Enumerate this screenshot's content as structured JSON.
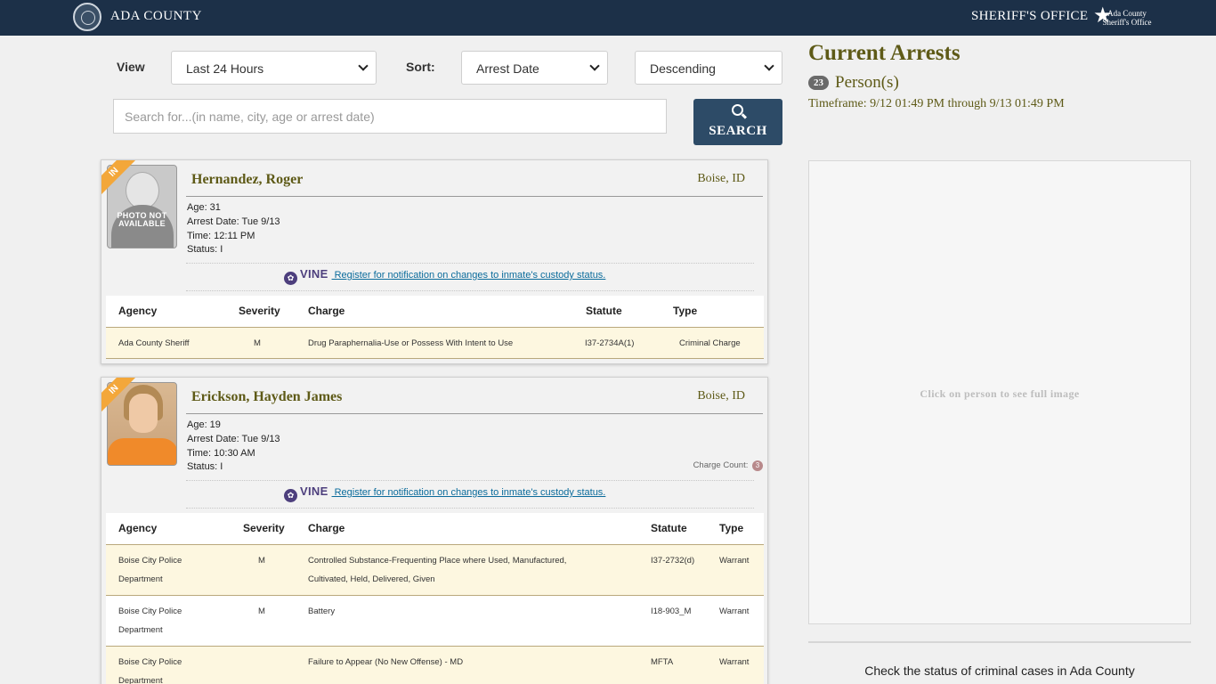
{
  "header": {
    "county": "ADA COUNTY",
    "office": "SHERIFF'S OFFICE",
    "logo_line1": "Ada County",
    "logo_line2": "Sheriff's Office"
  },
  "controls": {
    "view_label": "View",
    "view_value": "Last 24 Hours",
    "sort_label": "Sort:",
    "sort_value": "Arrest Date",
    "order_value": "Descending",
    "search_placeholder": "Search for...(in name, city, age or arrest date)",
    "search_button": "SEARCH"
  },
  "columns": {
    "agency": "Agency",
    "severity": "Severity",
    "charge": "Charge",
    "statute": "Statute",
    "type": "Type"
  },
  "vine": {
    "brand": "VINE",
    "link": " Register for notification on changes to inmate's custody status."
  },
  "arrests": [
    {
      "ribbon": "IN",
      "photo_text": "PHOTO NOT AVAILABLE",
      "name": "Hernandez, Roger",
      "city": "Boise, ID",
      "age": "Age: 31",
      "arrest_date": "Arrest Date: Tue 9/13",
      "time": "Time: 12:11 PM",
      "status": "Status: I",
      "charges": [
        {
          "agency": "Ada County Sheriff",
          "severity": "M",
          "charge": "Drug Paraphernalia-Use or Possess With Intent to Use",
          "statute": "I37-2734A(1)",
          "type": "Criminal Charge"
        }
      ]
    },
    {
      "ribbon": "IN",
      "name": "Erickson, Hayden James",
      "city": "Boise, ID",
      "age": "Age: 19",
      "arrest_date": "Arrest Date: Tue 9/13",
      "time": "Time: 10:30 AM",
      "status": "Status: I",
      "charge_count_label": "Charge Count:",
      "charge_count": "3",
      "charges": [
        {
          "agency": "Boise City Police Department",
          "severity": "M",
          "charge": "Controlled Substance-Frequenting Place where Used, Manufactured, Cultivated, Held, Delivered, Given",
          "statute": "I37-2732(d)",
          "type": "Warrant"
        },
        {
          "agency": "Boise City Police Department",
          "severity": "M",
          "charge": "Battery",
          "statute": "I18-903_M",
          "type": "Warrant"
        },
        {
          "agency": "Boise City Police Department",
          "severity": "",
          "charge": "Failure to Appear (No New Offense) - MD",
          "statute": "MFTA",
          "type": "Warrant"
        }
      ]
    }
  ],
  "panel": {
    "title": "Current Arrests",
    "count": "23",
    "persons_label": "Person(s)",
    "timeframe": "Timeframe: 9/12 01:49 PM through 9/13 01:49 PM",
    "viewer_hint": "Click on person to see full image",
    "cases_text": "Check the status of criminal cases in Ada County"
  },
  "colors": {
    "header_bg": "#1c3048",
    "accent_olive": "#5e5a17",
    "search_button": "#2d4b67",
    "ribbon": "#f3a73a",
    "row_alt": "#fdf7e0"
  }
}
